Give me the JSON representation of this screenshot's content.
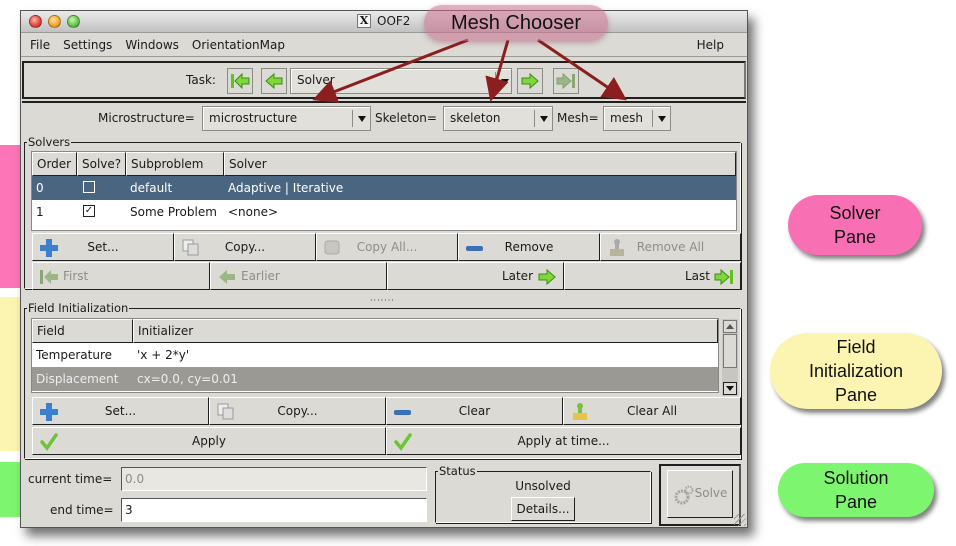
{
  "window": {
    "title": "OOF2",
    "menus": [
      "File",
      "Settings",
      "Windows",
      "OrientationMap"
    ],
    "help_menu": "Help"
  },
  "taskbar": {
    "label": "Task:",
    "current_task": "Solver"
  },
  "chooser": {
    "microstructure_label": "Microstructure=",
    "microstructure_value": "microstructure",
    "skeleton_label": "Skeleton=",
    "skeleton_value": "skeleton",
    "mesh_label": "Mesh=",
    "mesh_value": "mesh"
  },
  "solvers": {
    "legend": "Solvers",
    "columns": [
      "Order",
      "Solve?",
      "Subproblem",
      "Solver"
    ],
    "rows": [
      {
        "order": "0",
        "solve": false,
        "subproblem": "default",
        "solver": "Adaptive | Iterative",
        "selected": true
      },
      {
        "order": "1",
        "solve": true,
        "subproblem": "Some Problem",
        "solver": "<none>",
        "selected": false
      }
    ],
    "checked_mark": "✓",
    "buttons": {
      "set": "Set...",
      "copy": "Copy...",
      "copy_all": "Copy All...",
      "remove": "Remove",
      "remove_all": "Remove All",
      "first": "First",
      "earlier": "Earlier",
      "later": "Later",
      "last": "Last"
    }
  },
  "pane_handle": "·······",
  "field_init": {
    "legend": "Field Initialization",
    "columns": [
      "Field",
      "Initializer"
    ],
    "rows": [
      {
        "field": "Temperature",
        "initializer": "'x + 2*y'",
        "selected": false
      },
      {
        "field": "Displacement",
        "initializer": "cx=0.0, cy=0.01",
        "selected": true
      }
    ],
    "buttons": {
      "set": "Set...",
      "copy": "Copy...",
      "clear": "Clear",
      "clear_all": "Clear All",
      "apply": "Apply",
      "apply_at_time": "Apply at time..."
    }
  },
  "solution": {
    "current_time_label": "current time=",
    "current_time_value": "0.0",
    "end_time_label": "end time=",
    "end_time_value": "3",
    "status_legend": "Status",
    "status_text": "Unsolved",
    "details_button": "Details...",
    "solve_button": "Solve"
  },
  "annotations": {
    "mesh_chooser": "Mesh Chooser",
    "solver_pane": [
      "Solver",
      "Pane"
    ],
    "field_pane": [
      "Field",
      "Initialization",
      "Pane"
    ],
    "solution_pane": [
      "Solution",
      "Pane"
    ]
  },
  "colors": {
    "selected_row": "#4a6580",
    "selected_row_gray": "#9a9994",
    "arrow": "#8b1e1e",
    "solver_pane": "#fd75b7",
    "field_pane": "#fbf5b1",
    "solution_pane": "#7ef56f"
  }
}
